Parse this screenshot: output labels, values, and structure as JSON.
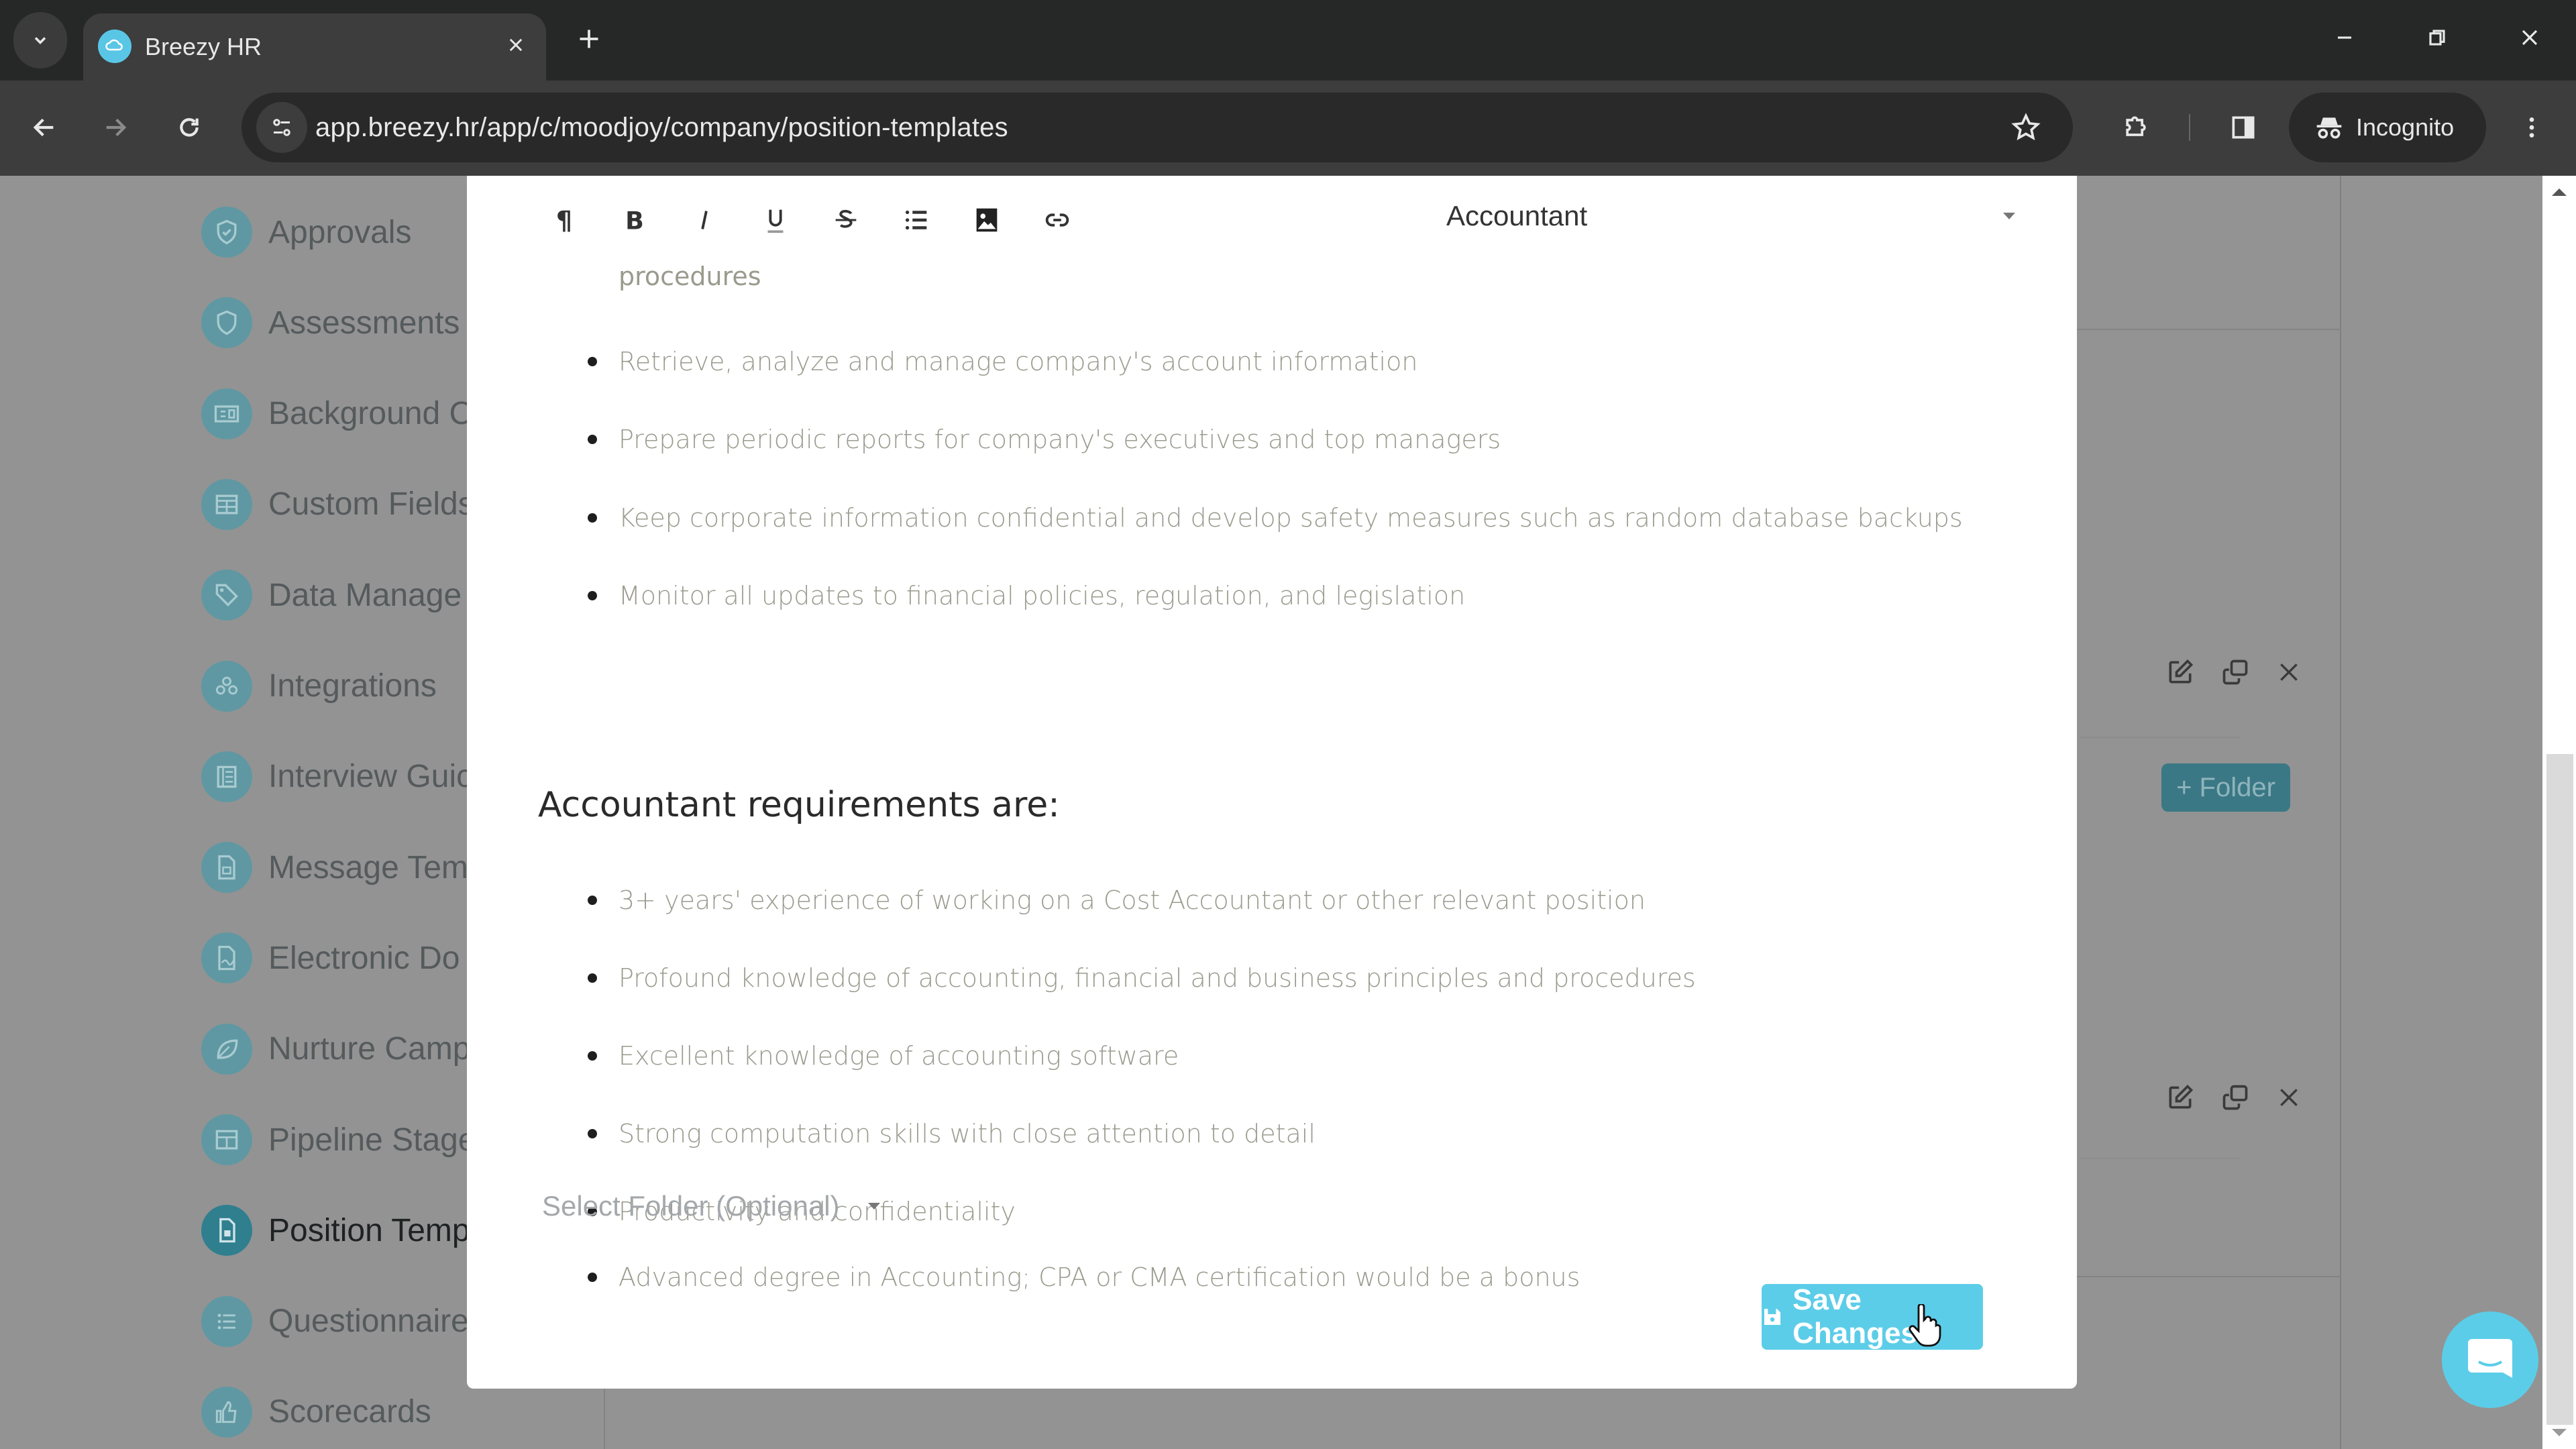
{
  "browser": {
    "tab_title": "Breezy HR",
    "url": "app.breezy.hr/app/c/moodjoy/company/position-templates",
    "incognito_label": "Incognito"
  },
  "sidebar": {
    "items": [
      {
        "label": "Approvals",
        "icon": "shield-check-icon",
        "active": false
      },
      {
        "label": "Assessments",
        "icon": "shield-icon",
        "active": false
      },
      {
        "label": "Background C",
        "icon": "id-card-icon",
        "active": false
      },
      {
        "label": "Custom Fields",
        "icon": "table-icon",
        "active": false
      },
      {
        "label": "Data Manage",
        "icon": "tag-icon",
        "active": false
      },
      {
        "label": "Integrations",
        "icon": "cubes-icon",
        "active": false
      },
      {
        "label": "Interview Guic",
        "icon": "book-icon",
        "active": false
      },
      {
        "label": "Message Tem",
        "icon": "file-icon",
        "active": false
      },
      {
        "label": "Electronic Do",
        "icon": "file-signature-icon",
        "active": false
      },
      {
        "label": "Nurture Camp",
        "icon": "leaf-icon",
        "active": false
      },
      {
        "label": "Pipeline Stage",
        "icon": "columns-icon",
        "active": false
      },
      {
        "label": "Position Temp",
        "icon": "file-text-icon",
        "active": true
      },
      {
        "label": "Questionnaire",
        "icon": "list-icon",
        "active": false
      },
      {
        "label": "Scorecards",
        "icon": "thumbs-up-icon",
        "active": false
      }
    ]
  },
  "background": {
    "folder_button": "+ Folder"
  },
  "modal": {
    "toolbar": [
      {
        "name": "paragraph",
        "glyph": "¶"
      },
      {
        "name": "bold",
        "glyph": "B"
      },
      {
        "name": "italic",
        "glyph": "I"
      },
      {
        "name": "underline",
        "glyph": "U"
      },
      {
        "name": "strikethrough",
        "glyph": "S"
      },
      {
        "name": "bullet-list",
        "glyph": "≡"
      },
      {
        "name": "image",
        "glyph": "▣"
      },
      {
        "name": "link",
        "glyph": "∞"
      }
    ],
    "template_selected": "Accountant",
    "continuation_text": "procedures",
    "responsibilities": [
      "Retrieve, analyze and manage company's account information",
      "Prepare periodic reports for company's executives and top managers",
      "Keep corporate information confidential and develop safety measures such as random database backups",
      "Monitor all updates to financial policies, regulation, and legislation"
    ],
    "requirements_heading": "Accountant requirements are:",
    "requirements": [
      "3+ years' experience of working on a Cost Accountant or other relevant position",
      "Profound knowledge of accounting, financial and business principles and procedures",
      "Excellent knowledge of accounting software",
      "Strong computation skills with close attention to detail",
      "Productivity and confidentiality",
      "Advanced degree in Accounting; CPA or CMA certification would be a bonus"
    ],
    "folder_placeholder": "Select Folder (Optional)",
    "save_label": "Save Changes"
  },
  "colors": {
    "accent": "#5ccde8",
    "sidebar_icon": "#5f98a2",
    "sidebar_icon_active": "#2f7f8f",
    "overlay": "#939393"
  }
}
